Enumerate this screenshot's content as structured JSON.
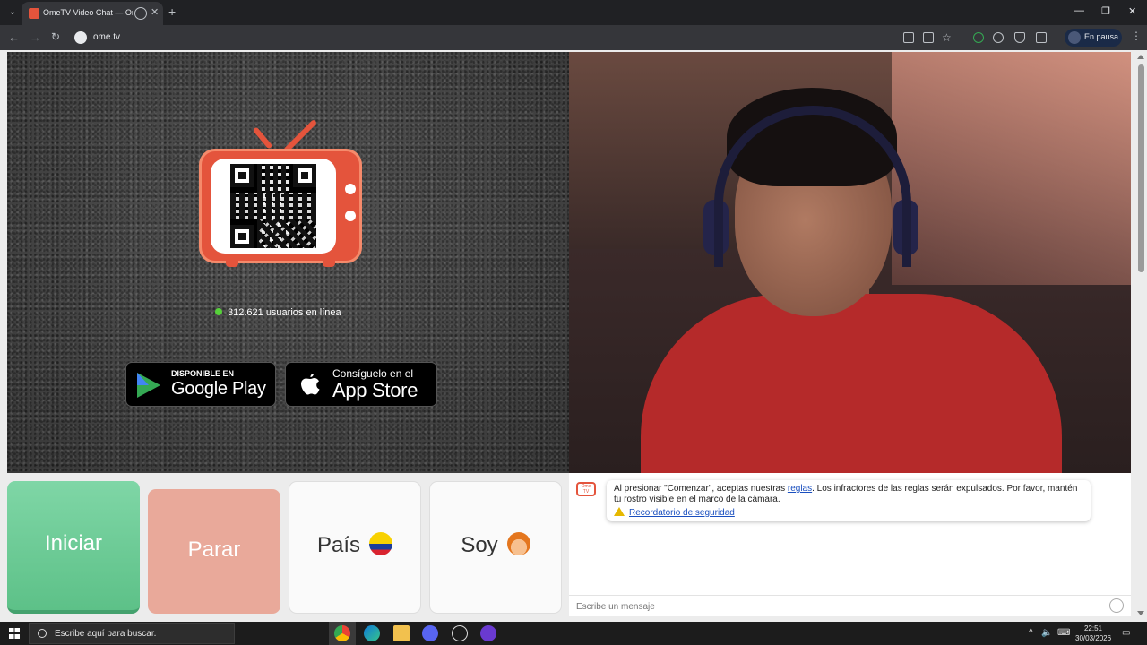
{
  "browser": {
    "tab_title": "OmeTV Video Chat — Ome...",
    "url": "ome.tv",
    "profile_status": "En pausa"
  },
  "left_panel": {
    "online_text": "312.621 usuarios en línea",
    "google_play": {
      "small": "DISPONIBLE EN",
      "big": "Google Play"
    },
    "app_store": {
      "small": "Consíguelo en el",
      "big": "App Store"
    }
  },
  "controls": {
    "start_label": "Iniciar",
    "stop_label": "Parar",
    "country_label": "País",
    "gender_label": "Soy"
  },
  "chat": {
    "logo_text": "Ome TV",
    "notice_before_link": "Al presionar \"Comenzar\", aceptas nuestras ",
    "notice_link": "reglas",
    "notice_after_link": ". Los infractores de las reglas serán expulsados. Por favor, mantén tu rostro visible en el marco de la cámara.",
    "safety_link": "Recordatorio de seguridad",
    "input_placeholder": "Escribe un mensaje"
  },
  "taskbar": {
    "search_placeholder": "Escribe aquí para buscar.",
    "time": "22:51",
    "date": "30/03/2026"
  },
  "colors": {
    "brand": "#e4543c",
    "start_green": "#5dc188",
    "stop_salmon": "#e9a99a",
    "online_green": "#56d13a"
  }
}
